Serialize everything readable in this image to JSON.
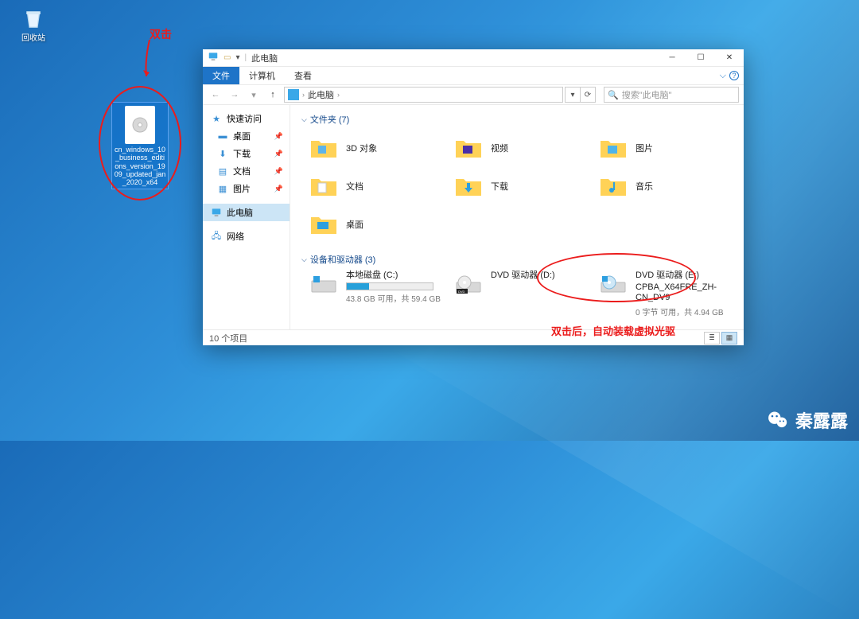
{
  "desktop": {
    "recycle_bin": "回收站",
    "iso_file_label": "cn_windows_10_business_editions_version_1909_updated_jan_2020_x64"
  },
  "annotations": {
    "double_click": "双击",
    "after_double_click": "双击后，自动装载虚拟光驱"
  },
  "window": {
    "title": "此电脑",
    "tabs": {
      "file": "文件",
      "computer": "计算机",
      "view": "查看"
    },
    "address": {
      "location": "此电脑"
    },
    "search_placeholder": "搜索\"此电脑\"",
    "sidebar": {
      "quick_access": "快速访问",
      "desktop": "桌面",
      "downloads": "下载",
      "documents": "文档",
      "pictures": "图片",
      "this_pc": "此电脑",
      "network": "网络"
    },
    "groups": {
      "folders_header": "文件夹 (7)",
      "folders": [
        {
          "name": "3D 对象"
        },
        {
          "name": "视频"
        },
        {
          "name": "图片"
        },
        {
          "name": "文档"
        },
        {
          "name": "下载"
        },
        {
          "name": "音乐"
        },
        {
          "name": "桌面"
        }
      ],
      "drives_header": "设备和驱动器 (3)",
      "drives": [
        {
          "name": "本地磁盘 (C:)",
          "sub": "43.8 GB 可用，共 59.4 GB",
          "fill_pct": 26
        },
        {
          "name": "DVD 驱动器 (D:)",
          "sub": ""
        },
        {
          "name": "DVD 驱动器 (E:)",
          "name2": "CPBA_X64FRE_ZH-CN_DV9",
          "sub": "0 字节 可用，共 4.94 GB"
        }
      ]
    },
    "status": "10 个项目"
  },
  "watermark": "秦露露"
}
